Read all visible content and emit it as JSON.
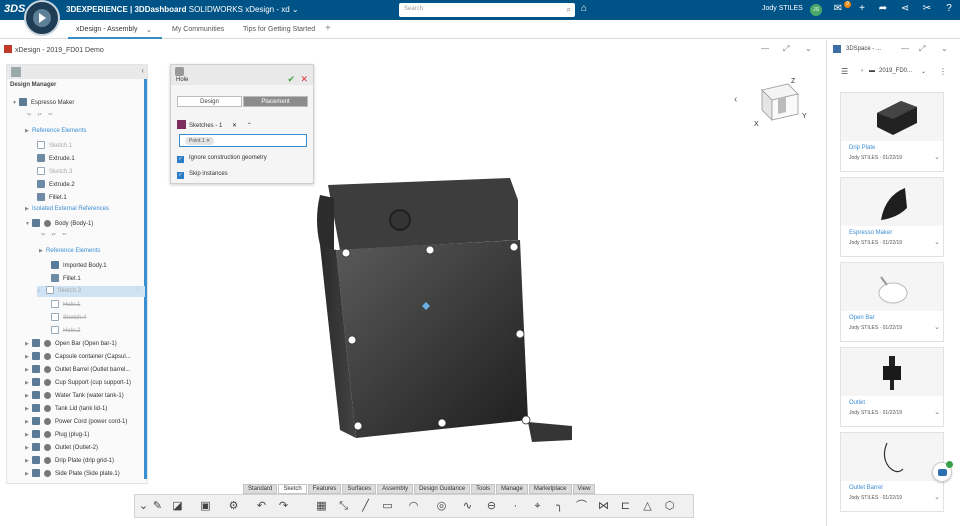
{
  "topbar": {
    "brand_logo": "3DS",
    "title_bold": "3DEXPERIENCE | 3DDashboard",
    "title_rest": "SOLIDWORKS xDesign - xd",
    "search_placeholder": "Search",
    "user_name": "Jody STILES",
    "user_initials": "JS",
    "notification_count": "9",
    "icons": [
      "tag-icon",
      "notification-icon",
      "add-icon",
      "share-icon",
      "network-icon",
      "tools-icon",
      "help-icon"
    ],
    "colors": {
      "bar": "#005386",
      "avatar": "#48a868",
      "badge": "#e98b17"
    }
  },
  "tabs": {
    "items": [
      "xDesign - Assembly",
      "My Communities",
      "Tips for Getting Started"
    ],
    "active": "xDesign - Assembly"
  },
  "document": {
    "title": "xDesign - 2019_FD01 Demo"
  },
  "design_manager": {
    "title": "Design Manager",
    "root": "Espresso Maker",
    "items": [
      {
        "label": "Reference Elements",
        "style": "blue"
      },
      {
        "label": "Sketch.1",
        "style": "grey"
      },
      {
        "label": "Extrude.1",
        "style": "normal"
      },
      {
        "label": "Sketch.3",
        "style": "grey"
      },
      {
        "label": "Extrude.2",
        "style": "normal"
      },
      {
        "label": "Fillet.1",
        "style": "normal"
      },
      {
        "label": "Isolated External References",
        "style": "blue"
      },
      {
        "label": "Body (Body-1)",
        "style": "normal"
      },
      {
        "label": "Reference Elements",
        "style": "blue"
      },
      {
        "label": "Imported Body.1",
        "style": "normal"
      },
      {
        "label": "Fillet.1",
        "style": "normal"
      },
      {
        "label": "Sketch.3",
        "style": "selected"
      },
      {
        "label": "Hole.1",
        "style": "strike"
      },
      {
        "label": "Sketch.4",
        "style": "strike"
      },
      {
        "label": "Hole.2",
        "style": "strike"
      },
      {
        "label": "Open Bar (Open bar-1)",
        "style": "normal"
      },
      {
        "label": "Capsule container (Capsul...",
        "style": "normal"
      },
      {
        "label": "Outlet Barrel (Outlet barrel...",
        "style": "normal"
      },
      {
        "label": "Cup Support (cup support-1)",
        "style": "normal"
      },
      {
        "label": "Water Tank (water tank-1)",
        "style": "normal"
      },
      {
        "label": "Tank Lid (tank lid-1)",
        "style": "normal"
      },
      {
        "label": "Power Cord (power cord-1)",
        "style": "normal"
      },
      {
        "label": "Plug (plug-1)",
        "style": "normal"
      },
      {
        "label": "Outlet (Outlet-2)",
        "style": "normal"
      },
      {
        "label": "Drip Plate (drip grid-1)",
        "style": "normal"
      },
      {
        "label": "Side Plate (Side plate.1)",
        "style": "normal"
      }
    ],
    "mini_labels": [
      "xy",
      "yz",
      "zx"
    ]
  },
  "hole_dialog": {
    "title": "Hole",
    "tabs": [
      "Design",
      "Placement"
    ],
    "active_tab": "Placement",
    "selection_label": "Sketches - 1",
    "point_chip": "Point.1",
    "checkboxes": [
      {
        "label": "Ignore construction geometry",
        "checked": true
      },
      {
        "label": "Skip instances",
        "checked": true
      }
    ]
  },
  "nav_cube": {
    "axes": [
      "Z",
      "X",
      "Y"
    ]
  },
  "bottom_tabs": {
    "items": [
      "Standard",
      "Sketch",
      "Features",
      "Surfaces",
      "Assembly",
      "Design Guidance",
      "Tools",
      "Manage",
      "Marketplace",
      "View"
    ],
    "active": "Sketch"
  },
  "toolbar": {
    "icons": [
      "sketch-tool-icon",
      "plane-icon",
      "feature-icon",
      "settings-icon",
      "undo-icon",
      "redo-icon",
      "grid-icon",
      "smart-dimension-icon",
      "line-icon",
      "arc-icon",
      "circle-icon",
      "spline-icon",
      "slot-icon",
      "point-icon",
      "trim-icon",
      "fillet-sketch-icon",
      "curve-icon",
      "pattern-icon",
      "offset-icon",
      "triangle-icon",
      "cube-icon"
    ]
  },
  "side_panel": {
    "title": "3DSpace - ...",
    "path": "2019_FD0...",
    "cards": [
      {
        "name": "Drip Plate",
        "meta": "Jody STILES  ·  01/22/19"
      },
      {
        "name": "Espresso Maker",
        "meta": "Jody STILES  ·  01/22/19"
      },
      {
        "name": "Open Bar",
        "meta": "Jody STILES  ·  01/22/19"
      },
      {
        "name": "Outlet",
        "meta": "Jody STILES  ·  01/22/19"
      },
      {
        "name": "Outlet Barrel",
        "meta": "Jody STILES  ·  01/22/19"
      }
    ]
  }
}
